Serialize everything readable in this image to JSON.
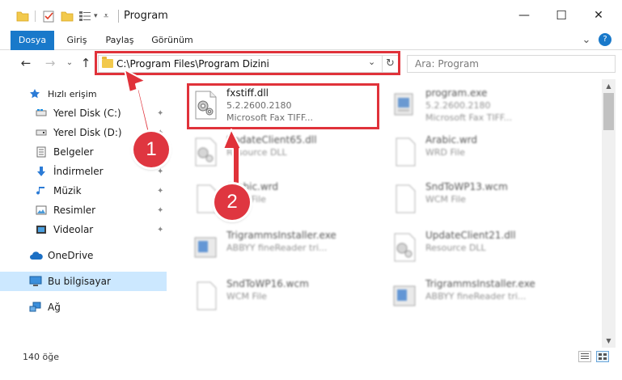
{
  "window": {
    "title": "Program",
    "min_glyph": "—",
    "max_glyph": "☐",
    "close_glyph": "✕"
  },
  "ribbon": {
    "tabs": [
      "Dosya",
      "Giriş",
      "Paylaş",
      "Görünüm"
    ],
    "collapse_glyph": "⌄",
    "help_glyph": "?"
  },
  "nav": {
    "back_glyph": "←",
    "forward_glyph": "→",
    "recent_glyph": "⌄",
    "up_glyph": "↑",
    "address": "C:\\Program Files\\Program Dizini",
    "address_dropdown_glyph": "⌄",
    "refresh_glyph": "↻",
    "search_placeholder": "Ara: Program"
  },
  "sidebar": {
    "items": [
      {
        "label": "Hızlı erişim",
        "icon": "star-icon",
        "pinned": false
      },
      {
        "label": "Yerel Disk (C:)",
        "icon": "drive-icon",
        "pinned": true
      },
      {
        "label": "Yerel Disk (D:)",
        "icon": "drive-icon",
        "pinned": true
      },
      {
        "label": "Belgeler",
        "icon": "documents-icon",
        "pinned": true
      },
      {
        "label": "İndirmeler",
        "icon": "download-icon",
        "pinned": true
      },
      {
        "label": "Müzik",
        "icon": "music-icon",
        "pinned": true
      },
      {
        "label": "Resimler",
        "icon": "pictures-icon",
        "pinned": true
      },
      {
        "label": "Videolar",
        "icon": "videos-icon",
        "pinned": true
      },
      {
        "label": "OneDrive",
        "icon": "cloud-icon",
        "pinned": false
      },
      {
        "label": "Bu bilgisayar",
        "icon": "computer-icon",
        "pinned": false,
        "selected": true
      },
      {
        "label": "Ağ",
        "icon": "network-icon",
        "pinned": false
      }
    ],
    "pin_glyph": "📌"
  },
  "files": [
    {
      "name": "fxstiff.dll",
      "line2": "5.2.2600.2180",
      "line3": "Microsoft  Fax TIFF...",
      "icon": "dll-gear-icon",
      "highlighted": true
    },
    {
      "name": "program.exe",
      "line2": "5.2.2600.2180",
      "line3": "Microsoft  Fax TIFF...",
      "icon": "exe-icon"
    },
    {
      "name": "UpdateClient65.dll",
      "line2": "Resource DLL",
      "line3": "",
      "icon": "dll-gear-icon"
    },
    {
      "name": "Arabic.wrd",
      "line2": "WRD File",
      "line3": "",
      "icon": "blank-file-icon"
    },
    {
      "name": "Arabic.wrd",
      "line2": "WRD File",
      "line3": "",
      "icon": "blank-file-icon"
    },
    {
      "name": "SndToWP13.wcm",
      "line2": "WCM File",
      "line3": "",
      "icon": "blank-file-icon"
    },
    {
      "name": "TrigrammsInstaller.exe",
      "line2": "ABBYY fineReader tri...",
      "line3": "",
      "icon": "installer-icon"
    },
    {
      "name": "UpdateClient21.dll",
      "line2": "Resource DLL",
      "line3": "",
      "icon": "dll-gear-icon"
    },
    {
      "name": "SndToWP16.wcm",
      "line2": "WCM File",
      "line3": "",
      "icon": "blank-file-icon"
    },
    {
      "name": "TrigrammsInstaller.exe",
      "line2": "ABBYY fineReader tri...",
      "line3": "",
      "icon": "installer-icon"
    }
  ],
  "status": {
    "count": "140 öğe"
  },
  "annotations": {
    "step1": "1",
    "step2": "2",
    "color": "#e0323a"
  },
  "colors": {
    "file_tab": "#1979ca",
    "selected": "#cce8ff",
    "folder": "#f2c94c"
  }
}
